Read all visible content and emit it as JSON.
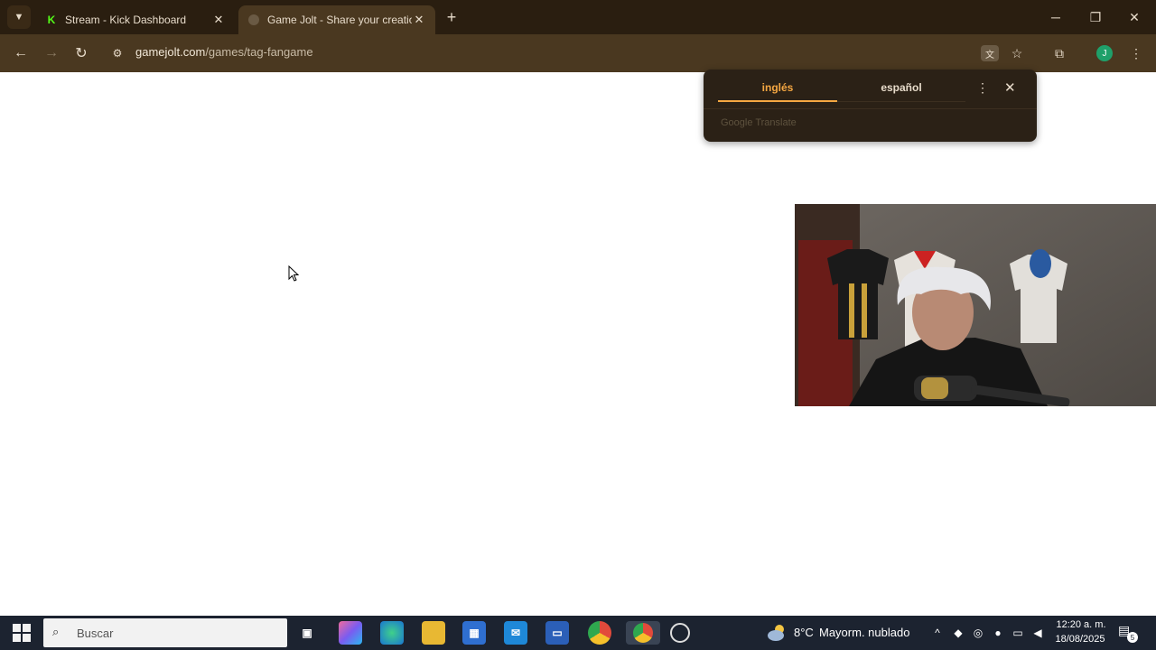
{
  "browser": {
    "tabs": [
      {
        "title": "Stream - Kick Dashboard",
        "active": false,
        "favicon": "kick-logo-icon"
      },
      {
        "title": "Game Jolt - Share your creations",
        "active": true,
        "favicon": "gamejolt-favicon-icon"
      }
    ],
    "url_host": "gamejolt.com",
    "url_path": "/games/tag-fangame",
    "profile_initial": "J"
  },
  "translate_popup": {
    "source_language": "inglés",
    "target_language": "español",
    "footer": "Google Translate"
  },
  "taskbar": {
    "search_placeholder": "Buscar",
    "weather_temp": "8°C",
    "weather_desc": "Mayorm. nublado",
    "time": "12:20 a. m.",
    "date": "18/08/2025",
    "notification_count": "5"
  },
  "colors": {
    "tabstrip": "#2a1e10",
    "toolbar": "#4a3820",
    "accent": "#f5a742",
    "taskbar": "#1c2330"
  }
}
